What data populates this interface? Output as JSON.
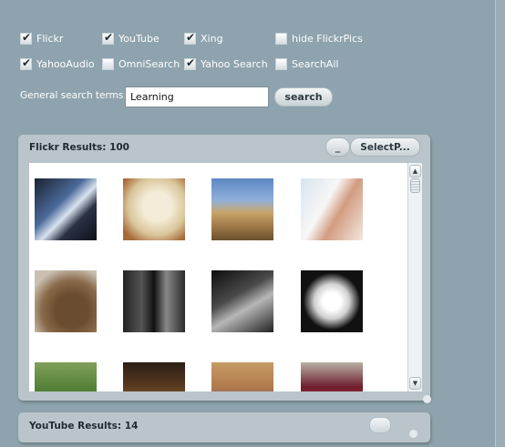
{
  "options": {
    "flickr": {
      "label": "Flickr",
      "checked": true
    },
    "youtube": {
      "label": "YouTube",
      "checked": true
    },
    "xing": {
      "label": "Xing",
      "checked": true
    },
    "hide_flickr_pics": {
      "label": "hide FlickrPics",
      "checked": false
    },
    "yahoo_audio": {
      "label": "YahooAudio",
      "checked": true
    },
    "omni_search": {
      "label": "OmniSearch",
      "checked": false
    },
    "yahoo_search": {
      "label": "Yahoo Search",
      "checked": true
    },
    "search_all": {
      "label": "SearchAll",
      "checked": false
    }
  },
  "search": {
    "label": "General search terms:",
    "value": "Learning",
    "button_label": "search"
  },
  "flickr_panel": {
    "title": "Flickr Results: 100",
    "minimize_label": "_",
    "select_label": "SelectP...",
    "thumbnails": [
      {
        "name": "thumb-laptop-screen"
      },
      {
        "name": "thumb-book-page"
      },
      {
        "name": "thumb-domed-building"
      },
      {
        "name": "thumb-hand-with-paper"
      },
      {
        "name": "thumb-bronze-statue"
      },
      {
        "name": "thumb-dark-doorway"
      },
      {
        "name": "thumb-hands-bw"
      },
      {
        "name": "thumb-white-flower"
      },
      {
        "name": "thumb-green-foliage"
      },
      {
        "name": "thumb-dim-room"
      },
      {
        "name": "thumb-group-photo"
      },
      {
        "name": "thumb-red-poster"
      }
    ]
  },
  "youtube_panel": {
    "title": "YouTube Results: 14"
  },
  "colors": {
    "background": "#8ea3ad",
    "panel": "#b9c5ca",
    "panel_title": "#1f2b31"
  }
}
